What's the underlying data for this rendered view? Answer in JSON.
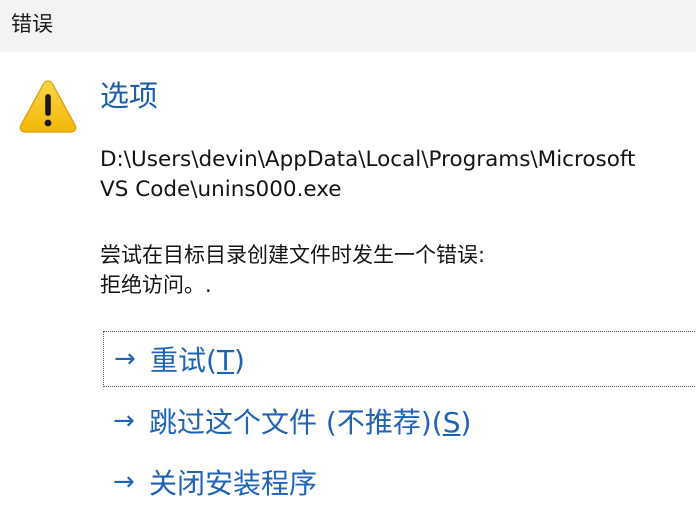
{
  "window": {
    "title": "错误"
  },
  "dialog": {
    "icon": "warning-icon",
    "heading": "选项",
    "path_line1": "D:\\Users\\devin\\AppData\\Local\\Programs\\Microsoft",
    "path_line2": "VS Code\\unins000.exe",
    "message_line1": "尝试在目标目录创建文件时发生一个错误:",
    "message_line2": "拒绝访问。."
  },
  "commands": [
    {
      "arrow": "→",
      "label_before": "重试(",
      "accel": "T",
      "label_after": ")"
    },
    {
      "arrow": "→",
      "label_before": "跳过这个文件 (不推荐)(",
      "accel": "S",
      "label_after": ")"
    },
    {
      "arrow": "→",
      "label_before": "关闭安装程序",
      "accel": "",
      "label_after": ""
    }
  ],
  "colors": {
    "heading": "#1c5ea8",
    "link": "#1f63b4",
    "title_bar_bg": "#f3f3f3",
    "warning_fill": "#f7c21a"
  }
}
